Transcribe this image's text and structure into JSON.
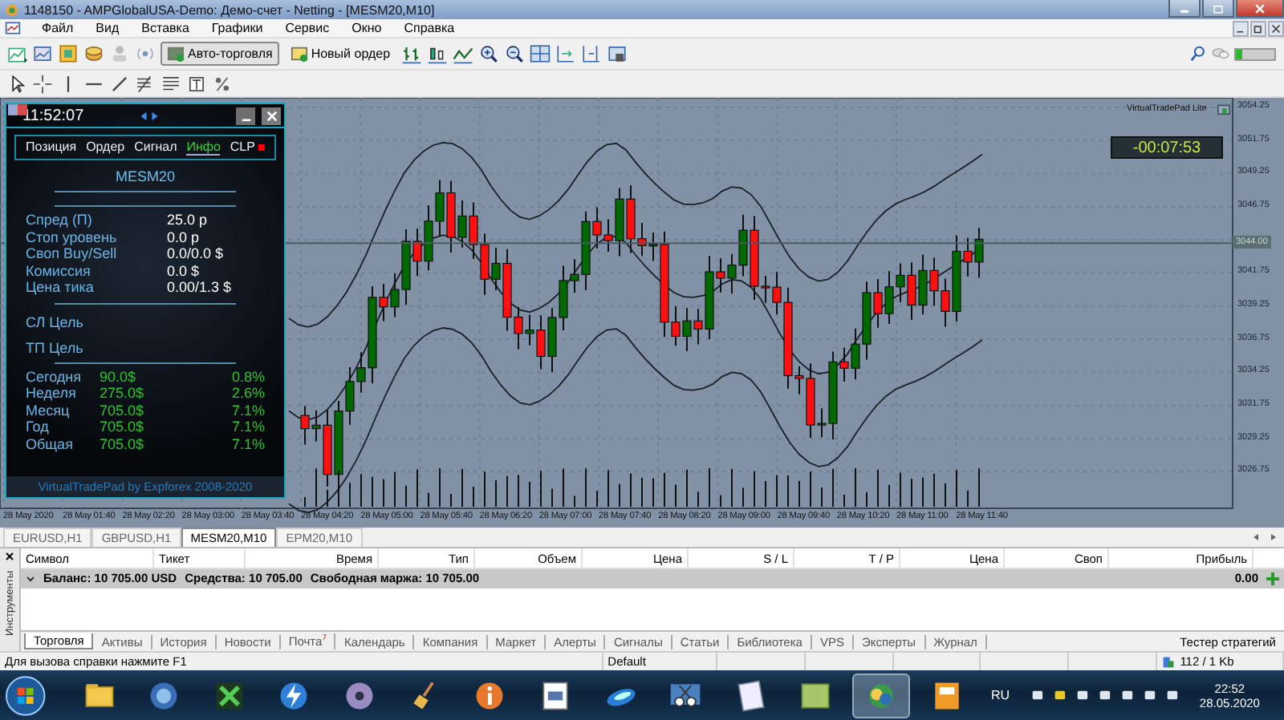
{
  "window": {
    "title": "1148150 - AMPGlobalUSA-Demo: Демо-счет - Netting - [MESM20,M10]"
  },
  "menu": [
    "Файл",
    "Вид",
    "Вставка",
    "Графики",
    "Сервис",
    "Окно",
    "Справка"
  ],
  "toolbar": {
    "buttons": [
      {
        "label": "Авто-торговля",
        "pressed": true
      },
      {
        "label": "Новый ордер",
        "pressed": false
      }
    ]
  },
  "chart": {
    "price_labels": [
      "3054.25",
      "3051.75",
      "3049.25",
      "3046.75",
      "3041.75",
      "3039.25",
      "3036.75",
      "3034.25",
      "3031.75",
      "3029.25",
      "3026.75"
    ],
    "current_price": "3044.00",
    "time_labels": [
      "28 May 2020",
      "28 May 01:40",
      "28 May 02:20",
      "28 May 03:00",
      "28 May 03:40",
      "28 May 04:20",
      "28 May 05:00",
      "28 May 05:40",
      "28 May 06:20",
      "28 May 07:00",
      "28 May 07:40",
      "28 May 08:20",
      "28 May 09:00",
      "28 May 09:40",
      "28 May 10:20",
      "28 May 11:00",
      "28 May 11:40"
    ],
    "overlay_label": "VirtualTradePad Lite",
    "countdown": "-00:07:53"
  },
  "trade_pad": {
    "time": "11:52:07",
    "tabs": [
      {
        "label": "Позиция",
        "selected": false
      },
      {
        "label": "Ордер",
        "selected": false
      },
      {
        "label": "Сигнал",
        "selected": false
      },
      {
        "label": "Инфо",
        "selected": true
      },
      {
        "label": "CLP",
        "selected": false,
        "status_dot": true
      }
    ],
    "symbol": "MESM20",
    "info": [
      {
        "label": "Спред (П)",
        "value": "25.0 p"
      },
      {
        "label": "Стоп уровень",
        "value": "0.0 p"
      },
      {
        "label": "Своп Buy/Sell",
        "value": "0.0/0.0 $"
      },
      {
        "label": "Комиссия",
        "value": "0.0 $"
      },
      {
        "label": "Цена тика",
        "value": "0.00/1.3 $"
      }
    ],
    "targets": [
      "СЛ Цель",
      "ТП Цель"
    ],
    "stats": [
      {
        "label": "Сегодня",
        "amount": "90.0$",
        "percent": "0.8%"
      },
      {
        "label": "Неделя",
        "amount": "275.0$",
        "percent": "2.6%"
      },
      {
        "label": "Месяц",
        "amount": "705.0$",
        "percent": "7.1%"
      },
      {
        "label": "Год",
        "amount": "705.0$",
        "percent": "7.1%"
      },
      {
        "label": "Общая",
        "amount": "705.0$",
        "percent": "7.1%"
      }
    ],
    "footer": "VirtualTradePad by Expforex 2008-2020"
  },
  "chart_tabs": [
    {
      "label": "EURUSD,H1",
      "selected": false
    },
    {
      "label": "GBPUSD,H1",
      "selected": false
    },
    {
      "label": "MESM20,M10",
      "selected": true
    },
    {
      "label": "EPM20,M10",
      "selected": false
    }
  ],
  "terminal": {
    "side_label": "Инструменты",
    "columns": [
      "Символ",
      "Тикет",
      "Время",
      "Тип",
      "Объем",
      "Цена",
      "S / L",
      "T / P",
      "Цена",
      "Своп",
      "Прибыль"
    ],
    "balance": [
      "Баланс: 10 705.00 USD",
      "Средства: 10 705.00",
      "Свободная маржа: 10 705.00"
    ],
    "profit": "0.00",
    "tabs": [
      {
        "label": "Торговля",
        "selected": true
      },
      {
        "label": "Активы",
        "selected": false
      },
      {
        "label": "История",
        "selected": false
      },
      {
        "label": "Новости",
        "selected": false
      },
      {
        "label": "Почта",
        "selected": false,
        "badge": "7"
      },
      {
        "label": "Календарь",
        "selected": false
      },
      {
        "label": "Компания",
        "selected": false
      },
      {
        "label": "Маркет",
        "selected": false
      },
      {
        "label": "Алерты",
        "selected": false
      },
      {
        "label": "Сигналы",
        "selected": false
      },
      {
        "label": "Статьи",
        "selected": false
      },
      {
        "label": "Библиотека",
        "selected": false
      },
      {
        "label": "VPS",
        "selected": false
      },
      {
        "label": "Эксперты",
        "selected": false
      },
      {
        "label": "Журнал",
        "selected": false
      }
    ],
    "tester_tab": "Тестер стратегий"
  },
  "status_bar": {
    "help": "Для вызова справки нажмите F1",
    "profile": "Default",
    "traffic": "112 / 1 Kb"
  },
  "taskbar": {
    "language": "RU",
    "time": "22:52",
    "date": "28.05.2020"
  }
}
